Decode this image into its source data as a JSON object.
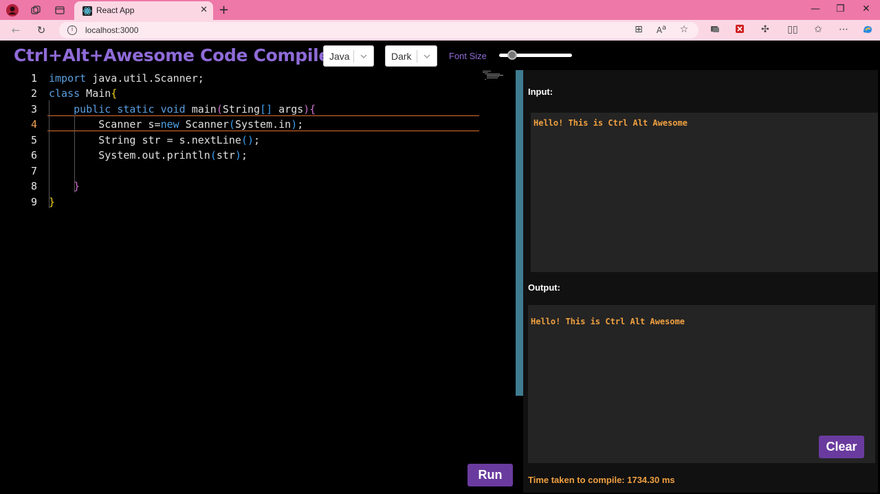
{
  "browser": {
    "tab_title": "React App",
    "url": "localhost:3000"
  },
  "app": {
    "title": "Ctrl+Alt+Awesome Code Compiler",
    "language_select": "Java",
    "theme_select": "Dark",
    "font_size_label": "Font Size",
    "font_size_fraction": 0.2,
    "accent_color": "#8f6bd8",
    "button_color": "#6a3b9e",
    "output_color": "#f0a040"
  },
  "editor": {
    "line_numbers": [
      "1",
      "2",
      "3",
      "4",
      "5",
      "6",
      "7",
      "8",
      "9"
    ],
    "active_line": 4
  },
  "panel": {
    "input_label": "Input:",
    "input_value": "Hello! This is Ctrl Alt Awesome",
    "output_label": "Output:",
    "output_value": "Hello! This is Ctrl Alt Awesome",
    "clear_label": "Clear",
    "time_text": "Time taken to compile: 1734.30 ms"
  },
  "run_label": "Run"
}
